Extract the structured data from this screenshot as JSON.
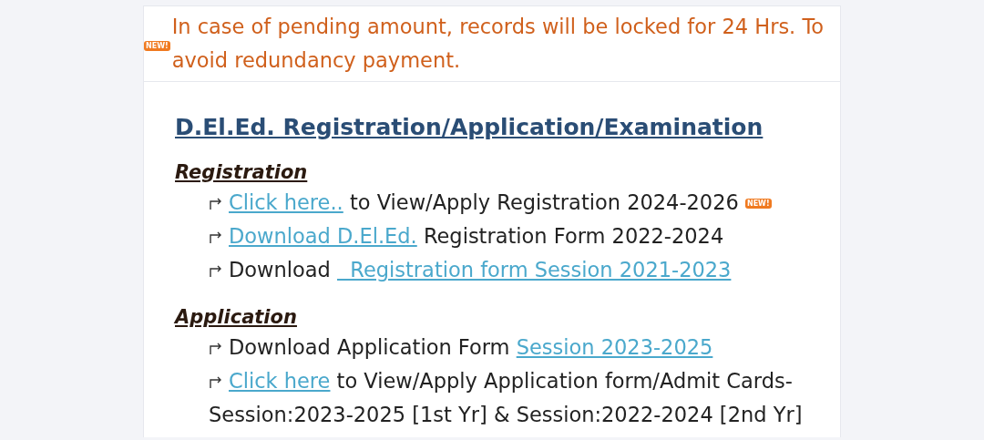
{
  "notice": {
    "badge": "NEW!",
    "text": "In case of pending amount, records will be locked for 24 Hrs. To avoid redundancy payment."
  },
  "heading": "D.El.Ed. Registration/Application/Examination",
  "sections": [
    {
      "title": "Registration",
      "items": [
        {
          "parts": [
            {
              "kind": "link",
              "text": "Click here.."
            },
            {
              "kind": "text",
              "text": " to View/Apply Registration 2024-2026"
            },
            {
              "kind": "badge",
              "text": "NEW!"
            }
          ]
        },
        {
          "parts": [
            {
              "kind": "link",
              "text": "Download D.El.Ed."
            },
            {
              "kind": "text",
              "text": " Registration Form 2022-2024"
            }
          ]
        },
        {
          "parts": [
            {
              "kind": "text",
              "text": "Download "
            },
            {
              "kind": "link",
              "text": "  Registration form Session 2021-2023"
            }
          ]
        }
      ]
    },
    {
      "title": "Application",
      "items": [
        {
          "parts": [
            {
              "kind": "text",
              "text": "Download Application Form"
            },
            {
              "kind": "link",
              "text": "Session 2023-2025"
            }
          ]
        },
        {
          "parts": [
            {
              "kind": "link",
              "text": "Click here"
            },
            {
              "kind": "text",
              "text": " to View/Apply Application form/Admit Cards-Session:2023-2025 [1st Yr] & Session:2022-2024 [2nd Yr]"
            }
          ]
        }
      ]
    }
  ]
}
